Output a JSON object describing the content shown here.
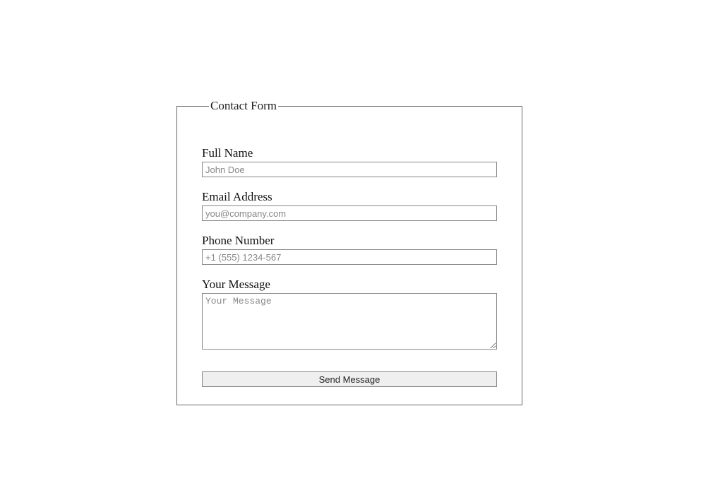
{
  "form": {
    "legend": "Contact Form",
    "fields": {
      "name": {
        "label": "Full Name",
        "placeholder": "John Doe",
        "value": ""
      },
      "email": {
        "label": "Email Address",
        "placeholder": "you@company.com",
        "value": ""
      },
      "phone": {
        "label": "Phone Number",
        "placeholder": "+1 (555) 1234-567",
        "value": ""
      },
      "message": {
        "label": "Your Message",
        "placeholder": "Your Message",
        "value": ""
      }
    },
    "submit_label": "Send Message"
  }
}
